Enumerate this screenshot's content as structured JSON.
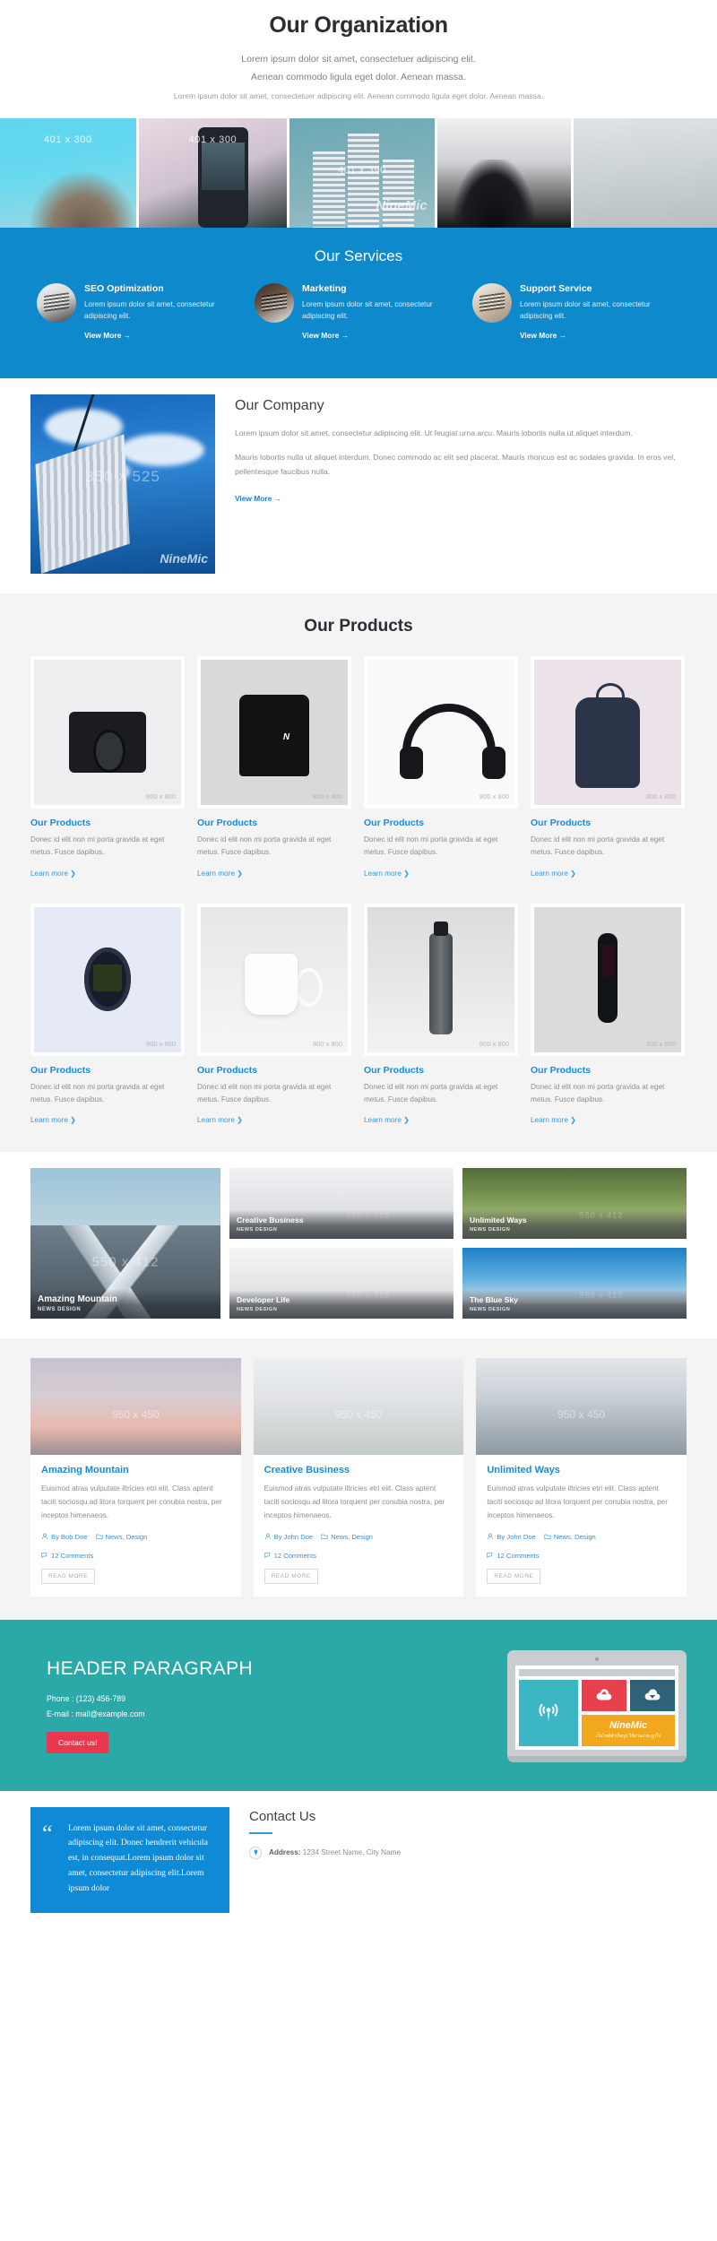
{
  "hero": {
    "title": "Our Organization",
    "line1": "Lorem ipsum dolor sit amet, consectetuer adipiscing elit.",
    "line2": "Aenean commodo ligula eget dolor. Aenean massa.",
    "line3": "Lorem ipsum dolor sit amet, consectetuer adipiscing elit. Aenean commodo ligula eget dolor. Aenean massa."
  },
  "banner": {
    "cells": [
      {
        "size": "401 x 300",
        "watermark": ""
      },
      {
        "size": "401 x 300",
        "watermark": ""
      },
      {
        "size": "401 x 390",
        "watermark": "NineMic"
      },
      {
        "size": "",
        "watermark": ""
      },
      {
        "size": "",
        "watermark": ""
      }
    ]
  },
  "services": {
    "heading": "Our Services",
    "items": [
      {
        "title": "SEO Optimization",
        "desc": "Lorem ipsum dolor sit amet, consectetur adipiscing elit.",
        "link": "View More →"
      },
      {
        "title": "Marketing",
        "desc": "Lorem ipsum dolor sit amet, consectetur adipiscing elit.",
        "link": "View More →"
      },
      {
        "title": "Support Service",
        "desc": "Lorem ipsum dolor sit amet, consectetur adipiscing elit.",
        "link": "View More →"
      }
    ]
  },
  "company": {
    "heading": "Our Company",
    "image_size": "350 x 525",
    "watermark": "NineMic",
    "p1": "Lorem ipsum dolor sit amet, consectetur adipiscing elit. Ut feugiat urna arcu. Mauris lobortis nulla ut aliquet interdum.",
    "p2": "Mauris lobortis nulla ut aliquet interdum. Donec commodo ac elit sed placerat. Mauris rhoncus est ac sodales gravida. In eros vel, pellentesque faucibus nulla.",
    "link": "View More →"
  },
  "products": {
    "heading": "Our Products",
    "card_title": "Our Products",
    "card_desc": "Donec id elit non mi porta gravida at eget metus. Fusce dapibus.",
    "card_link": "Learn more ❯",
    "image_size": "800 x 800",
    "row1": [
      {
        "art": "camera"
      },
      {
        "art": "shirt"
      },
      {
        "art": "head"
      },
      {
        "art": "bag"
      }
    ],
    "row2": [
      {
        "art": "watch"
      },
      {
        "art": "mug"
      },
      {
        "art": "bottle"
      },
      {
        "art": "band"
      }
    ]
  },
  "newsgrid": {
    "meta": "NEWS DESIGN",
    "size": "550 x 412",
    "big": {
      "title": "Amazing Mountain"
    },
    "small": [
      {
        "title": "Creative Business"
      },
      {
        "title": "Unlimited Ways"
      },
      {
        "title": "Developer Life"
      },
      {
        "title": "The Blue Sky"
      }
    ]
  },
  "blog": {
    "image_size": "950 x 450",
    "read_more": "READ MORE",
    "posts": [
      {
        "title": "Amazing Mountain",
        "desc": "Euismod atras vulputate iltricies etri elit. Class aptent taciti sociosqu ad litora torquent per conubia nostra, per inceptos himenaeos.",
        "author": "By Bob Doe",
        "cats": "News, Design",
        "comments": "12 Comments"
      },
      {
        "title": "Creative Business",
        "desc": "Euismod atras vulputate iltricies etri elit. Class aptent taciti sociosqu ad litora torquent per conubia nostra, per inceptos himenaeos.",
        "author": "By John Doe",
        "cats": "News, Design",
        "comments": "12 Comments"
      },
      {
        "title": "Unlimited Ways",
        "desc": "Euismod atras vulputate iltricies etri elit. Class aptent taciti sociosqu ad litora torquent per conubia nostra, per inceptos himenaeos.",
        "author": "By John Doe",
        "cats": "News, Design",
        "comments": "12 Comments"
      }
    ]
  },
  "cta": {
    "title": "HEADER PARAGRAPH",
    "phone": "Phone :  (123) 456-789",
    "email": "E-mail : mail@example.com",
    "button": "Contact us!",
    "brand": "NineMic",
    "tagline": "เว็บไซต์สำเร็จรูป ใช้งานง่าย ถูกใจ"
  },
  "footer": {
    "quote": "Lorem ipsum dolor sit amet, consectetur adipiscing elit. Donec hendrerit vehicula est, in consequat.Lorem ipsum dolor sit amet, consectetur adipiscing elit.Lorem ipsum dolor",
    "heading": "Contact Us",
    "address_label": "Address:",
    "address_value": "1234 Street Name, City Name"
  },
  "colors": {
    "services_blue": "#0d89cc",
    "link_blue": "#1b8ad6",
    "teal": "#2ba8a8",
    "red": "#e8384f",
    "quote_blue": "#0f8ad6"
  }
}
